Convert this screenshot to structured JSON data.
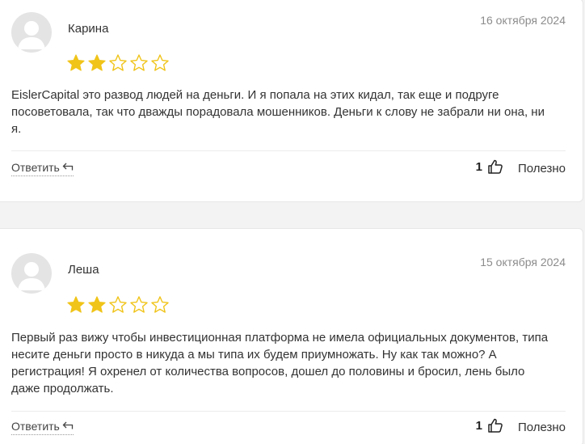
{
  "colors": {
    "star_filled": "#f0c419",
    "star_empty": "#f0c419",
    "avatar_bg": "#e4e4e4"
  },
  "reviews": [
    {
      "author": "Карина",
      "date": "16 октября 2024",
      "rating": 2,
      "max_rating": 5,
      "text": "EislerCapital это развод людей на деньги. И я попала на этих кидал, так еще и подруге посоветовала, так что дважды порадовала мошенников. Деньги к слову не забрали ни она, ни я.",
      "reply_label": "Ответить",
      "likes": "1",
      "useful_label": "Полезно"
    },
    {
      "author": "Леша",
      "date": "15 октября 2024",
      "rating": 2,
      "max_rating": 5,
      "text": "Первый раз вижу чтобы инвестиционная платформа не имела официальных документов, типа несите деньги просто в никуда а мы типа их будем приумножать. Ну как так можно? А регистрация! Я охренел от количества вопросов, дошел до половины и бросил, лень было даже продолжать.",
      "reply_label": "Ответить",
      "likes": "1",
      "useful_label": "Полезно"
    }
  ]
}
